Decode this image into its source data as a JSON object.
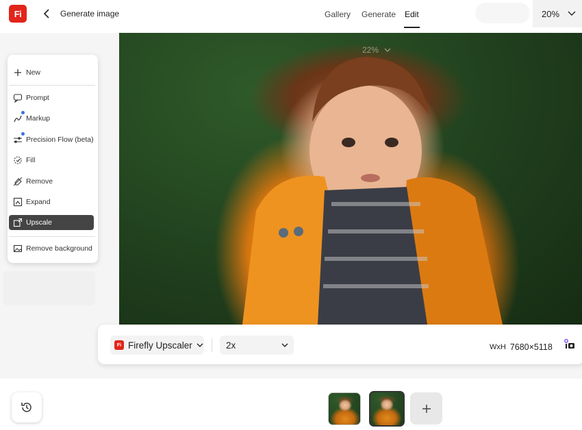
{
  "header": {
    "logo_text": "Fi",
    "title": "Generate image",
    "tabs": [
      {
        "label": "Gallery"
      },
      {
        "label": "Generate"
      },
      {
        "label": "Edit",
        "active": true
      }
    ],
    "zoom": "20%"
  },
  "canvas": {
    "zoom_overlay": "22%"
  },
  "tools": {
    "items": [
      {
        "label": "New",
        "icon": "plus-icon"
      },
      {
        "label": "Prompt",
        "icon": "prompt-icon"
      },
      {
        "label": "Markup",
        "icon": "markup-icon",
        "new_dot": true
      },
      {
        "label": "Precision Flow (beta)",
        "icon": "sliders-icon",
        "new_dot": true
      },
      {
        "label": "Fill",
        "icon": "fill-icon"
      },
      {
        "label": "Remove",
        "icon": "eraser-icon"
      },
      {
        "label": "Expand",
        "icon": "expand-icon"
      },
      {
        "label": "Upscale",
        "icon": "upscale-icon",
        "active": true
      },
      {
        "label": "Remove background",
        "icon": "image-icon"
      }
    ]
  },
  "options": {
    "model_logo": "Fi",
    "model": "Firefly Upscaler",
    "scale": "2x",
    "dims_label": "WxH",
    "dims_value": "7680×5118"
  },
  "colors": {
    "brand": "#e1251b",
    "active_tool": "#444444",
    "dot": "#3b6fe8"
  }
}
